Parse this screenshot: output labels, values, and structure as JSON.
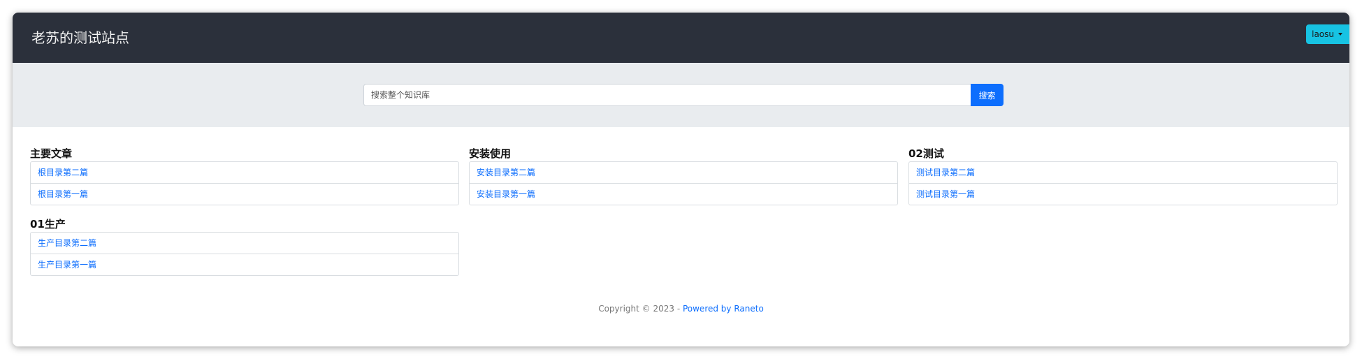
{
  "navbar": {
    "brand": "老苏的测试站点",
    "user_button": "laosu"
  },
  "search": {
    "placeholder": "搜索整个知识库",
    "button_label": "搜索"
  },
  "groups": [
    {
      "title": "主要文章",
      "items": [
        "根目录第二篇",
        "根目录第一篇"
      ]
    },
    {
      "title": "安装使用",
      "items": [
        "安装目录第二篇",
        "安装目录第一篇"
      ]
    },
    {
      "title": "02测试",
      "items": [
        "测试目录第二篇",
        "测试目录第一篇"
      ]
    },
    {
      "title": "01生产",
      "items": [
        "生产目录第二篇",
        "生产目录第一篇"
      ]
    }
  ],
  "footer": {
    "copyright": "Copyright © 2023 - ",
    "link": "Powered by Raneto"
  }
}
